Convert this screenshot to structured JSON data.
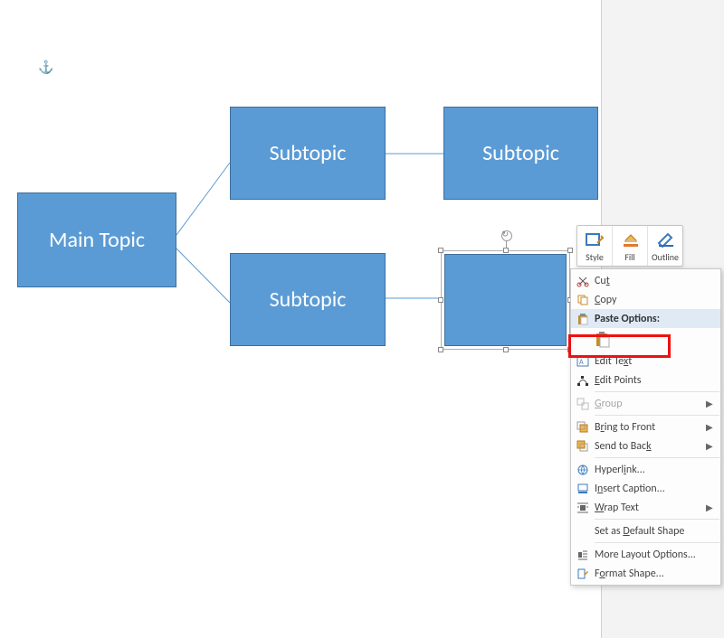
{
  "shapes": {
    "main": {
      "label": "Main Topic"
    },
    "sub_tl": {
      "label": "Subtopic"
    },
    "sub_tr": {
      "label": "Subtopic"
    },
    "sub_bl": {
      "label": "Subtopic"
    },
    "sub_br": {
      "label": ""
    }
  },
  "mini_toolbar": {
    "style": "Shape Styles",
    "fill": "Shape Fill",
    "outline": "Shape Outline",
    "style_lbl": "Style",
    "fill_lbl": "Fill",
    "outline_lbl": "Outline"
  },
  "context_menu": {
    "cut": "Cut",
    "copy": "Copy",
    "paste_options": "Paste Options:",
    "edit_text": "Edit Text",
    "edit_points": "Edit Points",
    "group": "Group",
    "bring_to_front": "Bring to Front",
    "send_to_back": "Send to Back",
    "hyperlink": "Hyperlink...",
    "insert_caption": "Insert Caption...",
    "wrap_text": "Wrap Text",
    "set_default": "Set as Default Shape",
    "more_layout": "More Layout Options...",
    "format_shape": "Format Shape..."
  }
}
